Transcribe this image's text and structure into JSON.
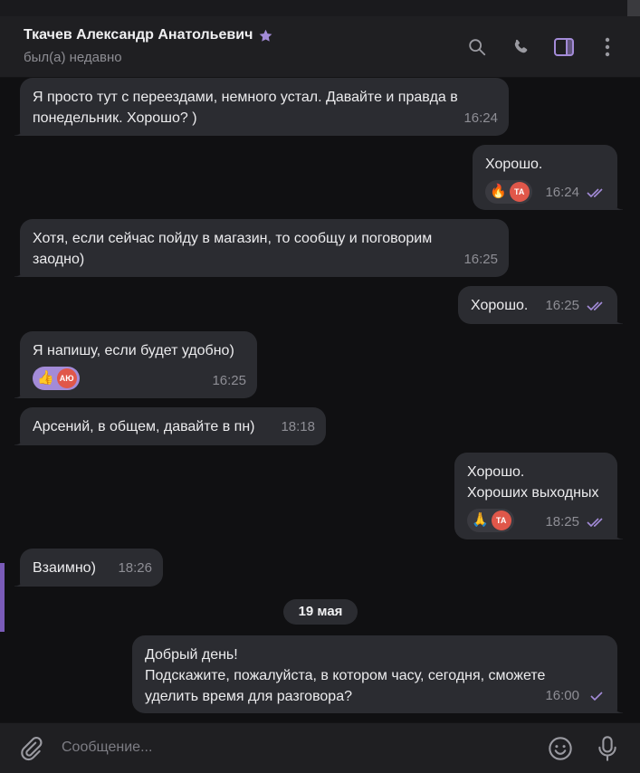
{
  "header": {
    "name": "Ткачев Александр Анатольевич",
    "status": "был(а) недавно"
  },
  "messages": [
    {
      "text": "Я просто тут с переездами, немного устал. Давайте и правда в понедельник. Хорошо? )",
      "time": "16:24",
      "dir": "in"
    },
    {
      "text": "Хорошо.",
      "time": "16:24",
      "dir": "out",
      "reactions": [
        {
          "emoji": "🔥",
          "initials": "ТА"
        }
      ],
      "read": true
    },
    {
      "text": "Хотя, если сейчас пойду в магазин, то сообщу и поговорим заодно)",
      "time": "16:25",
      "dir": "in"
    },
    {
      "text": "Хорошо.",
      "time": "16:25",
      "dir": "out",
      "read": true
    },
    {
      "text": "Я напишу, если будет удобно)",
      "time": "16:25",
      "dir": "in",
      "reactions": [
        {
          "emoji": "👍",
          "initials": "АЮ"
        }
      ]
    },
    {
      "text": "Арсений, в общем, давайте в пн)",
      "time": "18:18",
      "dir": "in"
    },
    {
      "text": "Хорошо.\nХороших выходных",
      "line1": "Хорошо.",
      "line2": "Хороших выходных",
      "time": "18:25",
      "dir": "out",
      "reactions": [
        {
          "emoji": "🙏",
          "initials": "ТА"
        }
      ],
      "read": true
    },
    {
      "text": "Взаимно)",
      "time": "18:26",
      "dir": "in"
    },
    {
      "line1": "Добрый день!",
      "line2": "Подскажите, пожалуйста, в котором часу, сегодня, сможете уделить время для разговора?",
      "time": "16:00",
      "dir": "out",
      "read": false
    }
  ],
  "date_separator": "19 мая",
  "composer": {
    "placeholder": "Сообщение..."
  },
  "colors": {
    "accent": "#a38bd8",
    "bubble": "#2b2c31",
    "background": "#101012"
  }
}
